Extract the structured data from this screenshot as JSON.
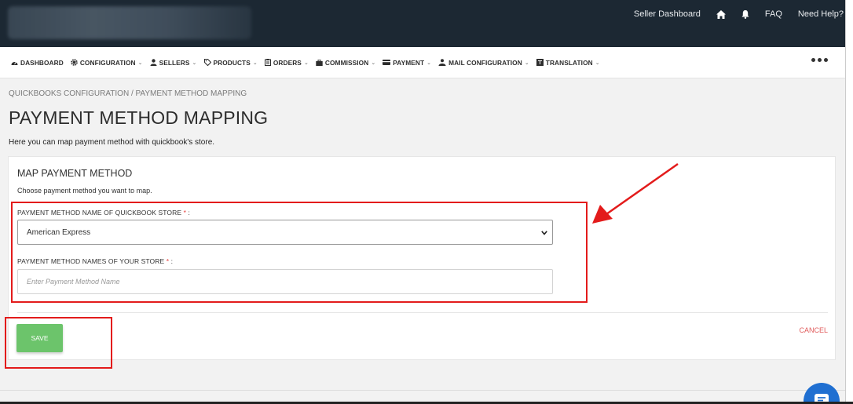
{
  "top_links": {
    "seller_dashboard": "Seller Dashboard",
    "faq": "FAQ",
    "need_help": "Need Help?"
  },
  "nav": {
    "dashboard": "DASHBOARD",
    "configuration": "CONFIGURATION",
    "sellers": "SELLERS",
    "products": "PRODUCTS",
    "orders": "ORDERS",
    "commission": "COMMISSION",
    "payment": "PAYMENT",
    "mail_configuration": "MAIL CONFIGURATION",
    "translation": "TRANSLATION",
    "chevron": "⌄"
  },
  "breadcrumb": "QUICKBOOKS CONFIGURATION / PAYMENT METHOD MAPPING",
  "page": {
    "title": "PAYMENT METHOD MAPPING",
    "subtitle": "Here you can map payment method with quickbook's store."
  },
  "form": {
    "title": "MAP PAYMENT METHOD",
    "subtitle": "Choose payment method you want to map.",
    "qb_label": "PAYMENT METHOD NAME OF QUICKBOOK STORE",
    "qb_value": "American Express",
    "store_label": "PAYMENT METHOD NAMES OF YOUR STORE",
    "store_placeholder": "Enter Payment Method Name",
    "required_mark": "*",
    "colon": ":"
  },
  "actions": {
    "save": "SAVE",
    "cancel": "CANCEL"
  },
  "colors": {
    "topbar": "#1c2833",
    "save_button": "#6cc46b",
    "highlight": "#e31b1b",
    "chat": "#1f6fd1"
  },
  "icons": [
    "home-icon",
    "bell-icon",
    "dashboard-icon",
    "gear-icon",
    "user-icon",
    "tag-icon",
    "clipboard-icon",
    "briefcase-icon",
    "card-icon",
    "envelope-user-icon",
    "translate-icon",
    "more-icon",
    "chat-icon",
    "chevron-down-icon"
  ]
}
